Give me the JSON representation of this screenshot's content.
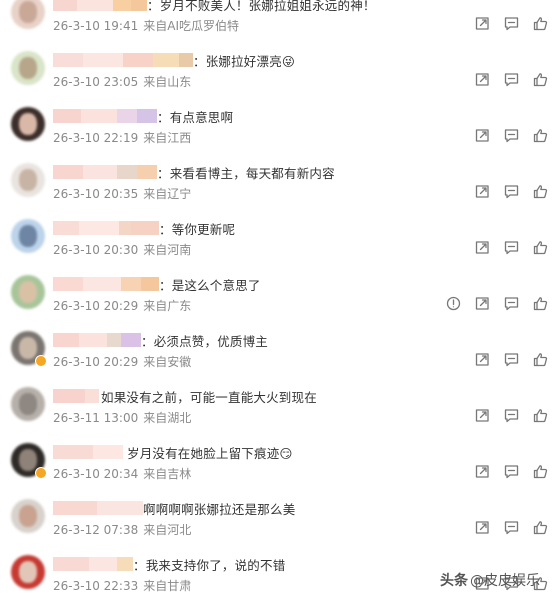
{
  "comments": [
    {
      "text": "：岁月不败美人！张娜拉姐姐永远的神！",
      "date": "26-3-10 19:41",
      "source": "来自AI吃瓜罗伯特",
      "avatar": [
        "#e8d2c8",
        "#c9a898"
      ],
      "vip": false
    },
    {
      "text": "：张娜拉好漂亮😜",
      "date": "26-3-10 23:05",
      "source": "来自山东",
      "avatar": [
        "#d9e4c8",
        "#b7a68a"
      ],
      "vip": false
    },
    {
      "text": "：有点意思啊",
      "date": "26-3-10 22:19",
      "source": "来自江西",
      "avatar": [
        "#3b2e2a",
        "#d9b8a8"
      ],
      "vip": false
    },
    {
      "text": "：来看看博主，每天都有新内容",
      "date": "26-3-10 20:35",
      "source": "来自辽宁",
      "avatar": [
        "#e9e4df",
        "#c8b4a4"
      ],
      "vip": false
    },
    {
      "text": "：等你更新呢",
      "date": "26-3-10 20:30",
      "source": "来自河南",
      "avatar": [
        "#bcd3ea",
        "#6e86a4"
      ],
      "vip": false
    },
    {
      "text": "：是这么个意思了",
      "date": "26-3-10 20:29",
      "source": "来自广东",
      "avatar": [
        "#a8c59a",
        "#d9c1a6"
      ],
      "vip": false
    },
    {
      "text": "：必须点赞，优质博主",
      "date": "26-3-10 20:29",
      "source": "来自安徽",
      "avatar": [
        "#7a7570",
        "#c9b8a8"
      ],
      "vip": true
    },
    {
      "text": "如果没有之前，可能一直能大火到现在",
      "date": "26-3-11 13:00",
      "source": "来自湖北",
      "avatar": [
        "#b7b0aa",
        "#8e8782"
      ],
      "vip": false
    },
    {
      "text": "岁月没有在她脸上留下痕迹😏",
      "date": "26-3-10 20:34",
      "source": "来自吉林",
      "avatar": [
        "#2e2a28",
        "#8f8278"
      ],
      "vip": true
    },
    {
      "text": "啊啊啊啊张娜拉还是那么美",
      "date": "26-3-12 07:38",
      "source": "来自河北",
      "avatar": [
        "#d8d2cc",
        "#c9a390"
      ],
      "vip": false
    },
    {
      "text": "：我来支持你了，说的不错",
      "date": "26-3-10 22:33",
      "source": "来自甘肃",
      "avatar": [
        "#c63a32",
        "#e2c6b8"
      ],
      "vip": false
    }
  ],
  "watermark": {
    "brand": "头条",
    "handle": "@皮皮娱乐"
  },
  "icons": [
    "report-icon",
    "repost-icon",
    "reply-icon",
    "like-icon"
  ]
}
